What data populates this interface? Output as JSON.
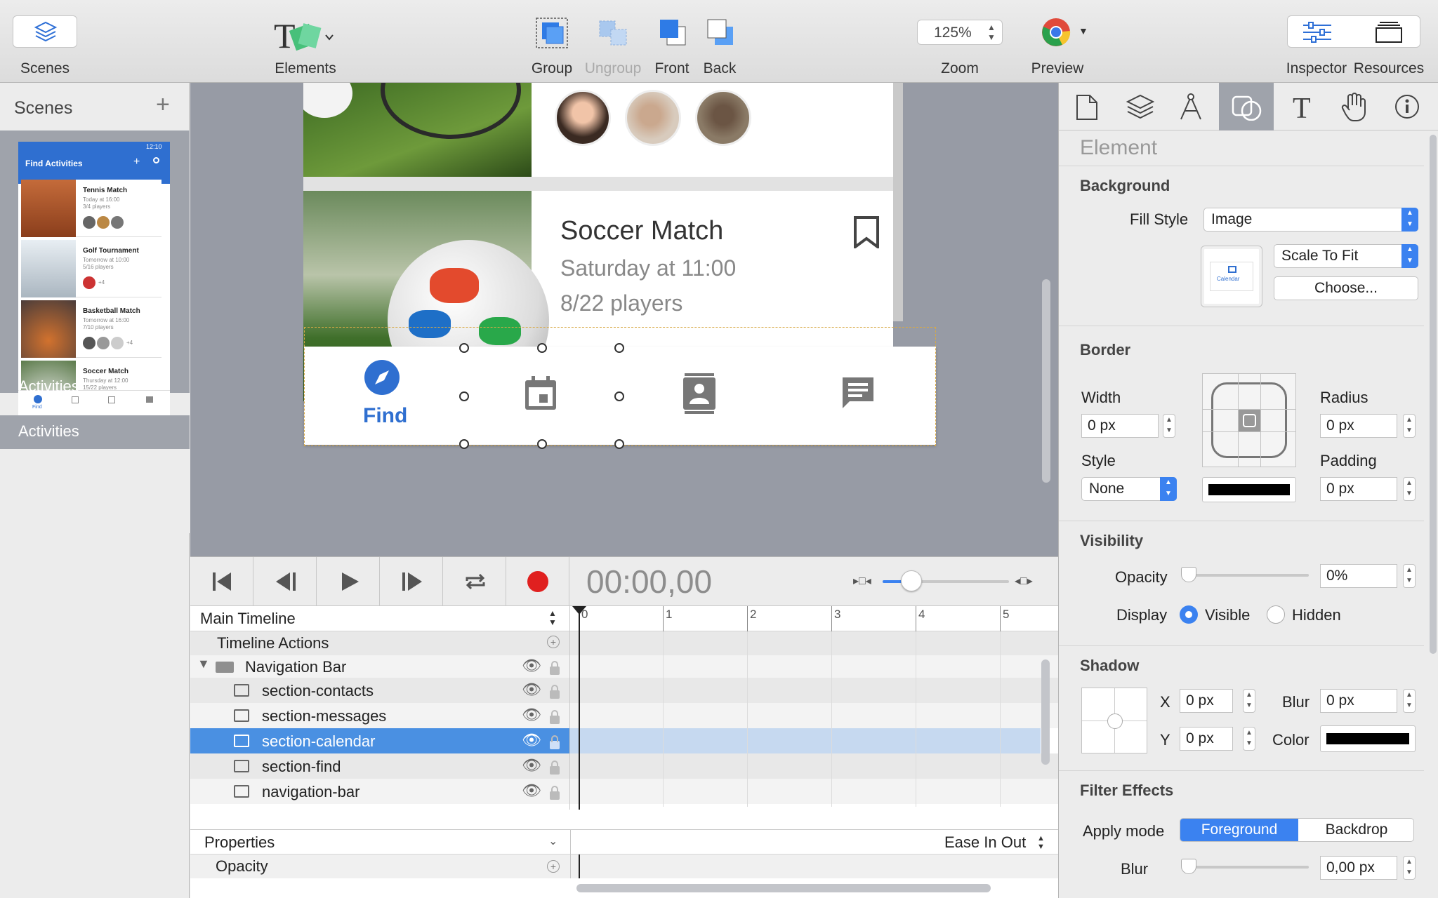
{
  "toolbar": {
    "scenes": "Scenes",
    "elements": "Elements",
    "group": "Group",
    "ungroup": "Ungroup",
    "front": "Front",
    "back": "Back",
    "zoom_value": "125%",
    "zoom": "Zoom",
    "preview": "Preview",
    "inspector": "Inspector",
    "resources": "Resources"
  },
  "scenes_panel": {
    "title": "Scenes",
    "add": "+",
    "scene_name": "Activities",
    "thumb": {
      "status_time": "12:10",
      "app_title": "Find Activities",
      "cards": [
        {
          "title": "Tennis Match",
          "time": "Today at 16:00",
          "players": "3/4 players",
          "extra": ""
        },
        {
          "title": "Golf Tournament",
          "time": "Tomorrow at 10:00",
          "players": "5/16 players",
          "extra": "+4"
        },
        {
          "title": "Basketball Match",
          "time": "Tomorrow at 16:00",
          "players": "7/10 players",
          "extra": "+4"
        },
        {
          "title": "Soccer Match",
          "time": "Thursday at 12:00",
          "players": "15/22 players",
          "extra": ""
        }
      ],
      "nav_find": "Find"
    }
  },
  "canvas": {
    "card_title": "Soccer Match",
    "card_time": "Saturday at 11:00",
    "card_players": "8/22 players",
    "nav_find": "Find"
  },
  "timeline": {
    "timecode": "00:00,00",
    "main_timeline": "Main Timeline",
    "timeline_actions": "Timeline Actions",
    "group": "Navigation Bar",
    "layers": [
      "section-contacts",
      "section-messages",
      "section-calendar",
      "section-find",
      "navigation-bar"
    ],
    "selected_layer": "section-calendar",
    "ruler": [
      "0",
      "1",
      "2",
      "3",
      "4",
      "5"
    ],
    "properties": "Properties",
    "easing": "Ease In Out",
    "opacity": "Opacity"
  },
  "inspector": {
    "title": "Element",
    "background": {
      "heading": "Background",
      "fill_style_label": "Fill Style",
      "fill_style": "Image",
      "image_caption": "Calendar",
      "scale": "Scale To Fit",
      "choose": "Choose..."
    },
    "border": {
      "heading": "Border",
      "width_label": "Width",
      "width": "0 px",
      "radius_label": "Radius",
      "radius": "0 px",
      "style_label": "Style",
      "style": "None",
      "padding_label": "Padding",
      "padding": "0 px"
    },
    "visibility": {
      "heading": "Visibility",
      "opacity_label": "Opacity",
      "opacity": "0%",
      "display_label": "Display",
      "visible": "Visible",
      "hidden": "Hidden"
    },
    "shadow": {
      "heading": "Shadow",
      "x_label": "X",
      "x": "0 px",
      "y_label": "Y",
      "y": "0 px",
      "blur_label": "Blur",
      "blur": "0 px",
      "color_label": "Color"
    },
    "filter": {
      "heading": "Filter Effects",
      "apply_mode_label": "Apply mode",
      "foreground": "Foreground",
      "backdrop": "Backdrop",
      "blur_label": "Blur",
      "blur": "0,00 px"
    }
  },
  "colors": {
    "accent": "#3b82f0",
    "selection": "#4a90e2",
    "canvas_bg": "#979ba5",
    "record": "#e0201f"
  }
}
